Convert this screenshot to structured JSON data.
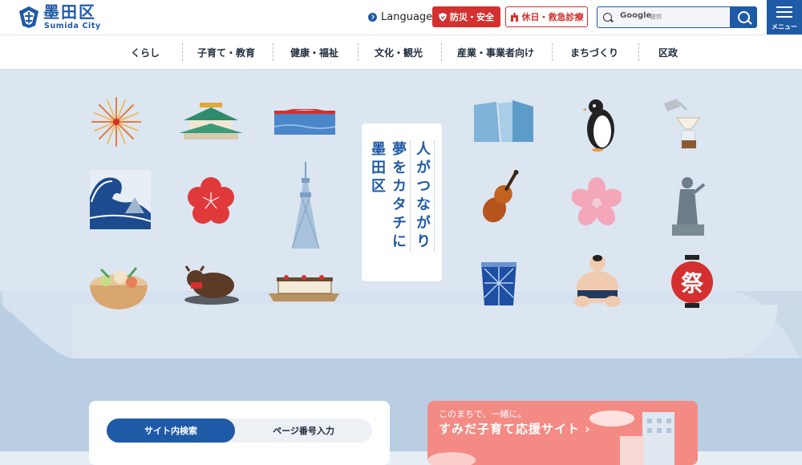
{
  "header": {
    "logo_name": "墨田区",
    "logo_sub": "Sumida City",
    "language_label": "Language",
    "bousai_label": "防災・安全",
    "kyujitsu_label": "休日・救急診療",
    "search_google": "Google",
    "search_teikyo": "提供",
    "menu_label": "メニュー"
  },
  "nav": {
    "items": [
      "くらし",
      "子育て・教育",
      "健康・福祉",
      "文化・観光",
      "産業・事業者向け",
      "まちづくり",
      "区政"
    ]
  },
  "hero": {
    "slogan_col1": "人がつながり",
    "slogan_col2": "夢をカタチに",
    "slogan_col3": "墨田区"
  },
  "search_card": {
    "tab_active": "サイト内検索",
    "tab_other": "ページ番号入力"
  },
  "promo": {
    "small": "このまちで、一緒に。",
    "big": "すみだ子育て応援サイト ›"
  },
  "colors": {
    "primary": "#1f5aa6",
    "alert": "#d3302f",
    "hero_bg": "#dbe6f1",
    "promo_bg": "#f48a84"
  }
}
